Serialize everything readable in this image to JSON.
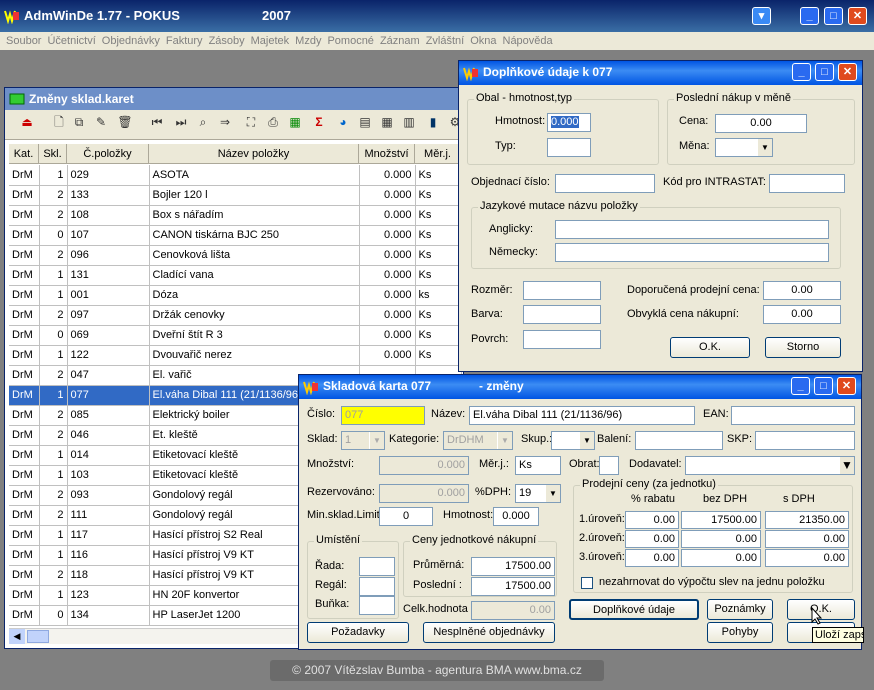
{
  "app": {
    "title": "AdmWinDe 1.77 - POKUS",
    "year": "2007"
  },
  "menu": [
    "Soubor",
    "Účetnictví",
    "Objednávky",
    "Faktury",
    "Zásoby",
    "Majetek",
    "Mzdy",
    "Pomocné",
    "Záznam",
    "Zvláštní",
    "Okna",
    "Nápověda"
  ],
  "stock_window": {
    "title": "Změny sklad.karet",
    "columns": [
      "Kat.",
      "Skl.",
      "Č.položky",
      "Název položky",
      "Množství",
      "Měr.j."
    ],
    "rows": [
      [
        "DrM",
        "1",
        "029",
        "ASOTA",
        "0.000",
        "Ks"
      ],
      [
        "DrM",
        "2",
        "133",
        "Bojler 120 l",
        "0.000",
        "Ks"
      ],
      [
        "DrM",
        "2",
        "108",
        "Box s nářadím",
        "0.000",
        "Ks"
      ],
      [
        "DrM",
        "0",
        "107",
        "CANON tiskárna BJC 250",
        "0.000",
        "Ks"
      ],
      [
        "DrM",
        "2",
        "096",
        "Cenovková lišta",
        "0.000",
        "Ks"
      ],
      [
        "DrM",
        "1",
        "131",
        "Cladící vana",
        "0.000",
        "Ks"
      ],
      [
        "DrM",
        "1",
        "001",
        "Dóza",
        "0.000",
        "ks"
      ],
      [
        "DrM",
        "2",
        "097",
        "Držák cenovky",
        "0.000",
        "Ks"
      ],
      [
        "DrM",
        "0",
        "069",
        "Dveřní štít R 3",
        "0.000",
        "Ks"
      ],
      [
        "DrM",
        "1",
        "122",
        "Dvouvařič nerez",
        "0.000",
        "Ks"
      ],
      [
        "DrM",
        "2",
        "047",
        "El. vařič",
        "",
        ""
      ],
      [
        "DrM",
        "1",
        "077",
        "El.váha Dibal 111 (21/1136/96)",
        "",
        ""
      ],
      [
        "DrM",
        "2",
        "085",
        "Elektrický boiler",
        "",
        ""
      ],
      [
        "DrM",
        "2",
        "046",
        "Et. kleště",
        "",
        ""
      ],
      [
        "DrM",
        "1",
        "014",
        "Etiketovací kleště",
        "",
        ""
      ],
      [
        "DrM",
        "1",
        "103",
        "Etiketovací kleště",
        "",
        ""
      ],
      [
        "DrM",
        "2",
        "093",
        "Gondolový regál",
        "",
        ""
      ],
      [
        "DrM",
        "2",
        "111",
        "Gondolový regál",
        "",
        ""
      ],
      [
        "DrM",
        "1",
        "117",
        "Hasící přístroj S2 Real",
        "",
        ""
      ],
      [
        "DrM",
        "1",
        "116",
        "Hasící přístroj V9 KT",
        "",
        ""
      ],
      [
        "DrM",
        "2",
        "118",
        "Hasící přístroj V9 KT",
        "",
        ""
      ],
      [
        "DrM",
        "1",
        "123",
        "HN 20F konvertor",
        "",
        ""
      ],
      [
        "DrM",
        "0",
        "134",
        "HP LaserJet 1200",
        "",
        ""
      ]
    ],
    "selected_index": 11
  },
  "extra_dialog": {
    "title": "Doplňkové údaje k 077",
    "group_obal": "Obal - hmotnost,typ",
    "hmotnost_label": "Hmotnost:",
    "hmotnost_value": "0.000",
    "typ_label": "Typ:",
    "group_nakup": "Poslední nákup v měně",
    "cena_label": "Cena:",
    "cena_value": "0.00",
    "mena_label": "Měna:",
    "obj_cislo_label": "Objednací číslo:",
    "intrastat_label": "Kód pro INTRASTAT:",
    "group_jazyk": "Jazykové mutace názvu položky",
    "anglicky_label": "Anglicky:",
    "nemecky_label": "Německy:",
    "rozmer_label": "Rozměr:",
    "barva_label": "Barva:",
    "povrch_label": "Povrch:",
    "dop_cena_label": "Doporučená prodejní cena:",
    "dop_cena_value": "0.00",
    "obv_cena_label": "Obvyklá cena nákupní:",
    "obv_cena_value": "0.00",
    "ok_label": "O.K.",
    "storno_label": "Storno"
  },
  "card_dialog": {
    "title": "Skladová karta 077",
    "subtitle": "- změny",
    "cislo_label": "Číslo:",
    "cislo_value": "077",
    "nazev_label": "Název:",
    "nazev_value": "El.váha Dibal 111 (21/1136/96)",
    "ean_label": "EAN:",
    "sklad_label": "Sklad:",
    "sklad_value": "1",
    "kategorie_label": "Kategorie:",
    "kategorie_value": "DrDHM",
    "skup_label": "Skup.:",
    "baleni_label": "Balení:",
    "skp_label": "SKP:",
    "mnozstvi_label": "Množství:",
    "mnozstvi_value": "0.000",
    "merj_label": "Měr.j.:",
    "merj_value": "Ks",
    "obrat_label": "Obrat:",
    "dodavatel_label": "Dodavatel:",
    "rezervovano_label": "Rezervováno:",
    "rezervovano_value": "0.000",
    "dph_label": "%DPH:",
    "dph_value": "19",
    "minsklad_label": "Min.sklad.Limit",
    "minsklad_value": "0",
    "hmotnost_label": "Hmotnost:",
    "hmotnost_value": "0.000",
    "group_ceny": "Prodejní ceny (za jednotku)",
    "col_rabat": "% rabatu",
    "col_bezdph": "bez DPH",
    "col_sdph": "s DPH",
    "levels": [
      {
        "label": "1.úroveň:",
        "rabat": "0.00",
        "bez": "17500.00",
        "s": "21350.00"
      },
      {
        "label": "2.úroveň:",
        "rabat": "0.00",
        "bez": "0.00",
        "s": "0.00"
      },
      {
        "label": "3.úroveň:",
        "rabat": "0.00",
        "bez": "0.00",
        "s": "0.00"
      }
    ],
    "nezahrnovat_label": "nezahrnovat do výpočtu slev na jednu položku",
    "group_umisteni": "Umístění",
    "rada_label": "Řada:",
    "regal_label": "Regál:",
    "bunka_label": "Buňka:",
    "group_nakupni": "Ceny jednotkové nákupní",
    "prumerna_label": "Průměrná:",
    "prumerna_value": "17500.00",
    "posledni_label": "Poslední :",
    "posledni_value": "17500.00",
    "celk_label": "Celk.hodnota :",
    "celk_value": "0.00",
    "btn_doplnkove": "Doplňkové údaje",
    "btn_poznamky": "Poznámky",
    "btn_ok": "O.K.",
    "btn_pozadavky": "Požadavky",
    "btn_nesplnene": "Nesplněné objednávky",
    "btn_pohyby": "Pohyby",
    "btn_storno": "St",
    "tooltip": "Uloží zapsan"
  },
  "status": {
    "copyright": "© 2007 Vítězslav Bumba - agentura BMA   www.bma.cz"
  }
}
